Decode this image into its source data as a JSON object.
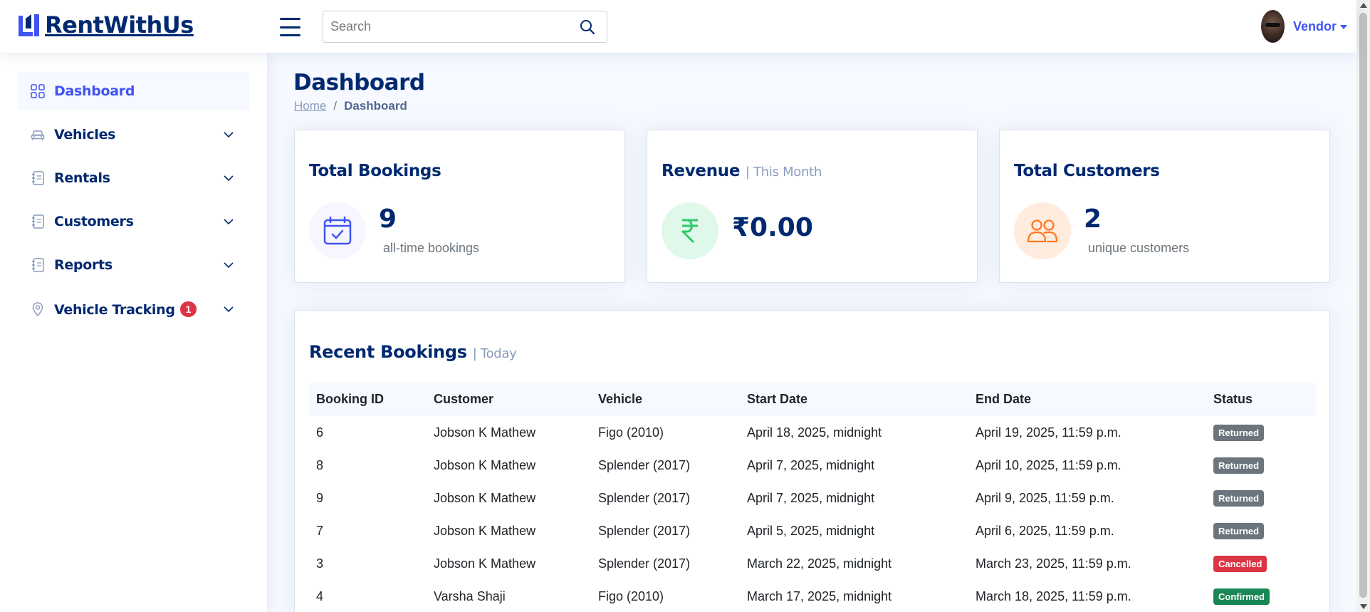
{
  "header": {
    "logo_text": "RentWithUs",
    "search_placeholder": "Search",
    "user_name": "Vendor"
  },
  "sidebar": {
    "items": [
      {
        "label": "Dashboard",
        "icon": "grid-icon",
        "active": true
      },
      {
        "label": "Vehicles",
        "icon": "car-icon"
      },
      {
        "label": "Rentals",
        "icon": "journal-icon"
      },
      {
        "label": "Customers",
        "icon": "journal-icon"
      },
      {
        "label": "Reports",
        "icon": "journal-icon"
      },
      {
        "label": "Vehicle Tracking",
        "icon": "geo-pin-icon",
        "badge": "1"
      }
    ]
  },
  "page": {
    "title": "Dashboard",
    "breadcrumb": {
      "home": "Home",
      "separator": "/",
      "current": "Dashboard"
    }
  },
  "cards": {
    "bookings": {
      "title": "Total Bookings",
      "value": "9",
      "caption": "all-time bookings",
      "icon": "calendar-check-icon"
    },
    "revenue": {
      "title": "Revenue",
      "subtitle": "| This Month",
      "value": "₹0.00",
      "icon": "rupee-icon"
    },
    "customers": {
      "title": "Total Customers",
      "value": "2",
      "caption": "unique customers",
      "icon": "people-icon"
    }
  },
  "recent_bookings": {
    "title": "Recent Bookings",
    "subtitle": "| Today",
    "columns": [
      "Booking ID",
      "Customer",
      "Vehicle",
      "Start Date",
      "End Date",
      "Status"
    ],
    "rows": [
      {
        "id": "6",
        "customer": "Jobson K Mathew",
        "vehicle": "Figo (2010)",
        "start": "April 18, 2025, midnight",
        "end": "April 19, 2025, 11:59 p.m.",
        "status": "Returned"
      },
      {
        "id": "8",
        "customer": "Jobson K Mathew",
        "vehicle": "Splender (2017)",
        "start": "April 7, 2025, midnight",
        "end": "April 10, 2025, 11:59 p.m.",
        "status": "Returned"
      },
      {
        "id": "9",
        "customer": "Jobson K Mathew",
        "vehicle": "Splender (2017)",
        "start": "April 7, 2025, midnight",
        "end": "April 9, 2025, 11:59 p.m.",
        "status": "Returned"
      },
      {
        "id": "7",
        "customer": "Jobson K Mathew",
        "vehicle": "Splender (2017)",
        "start": "April 5, 2025, midnight",
        "end": "April 6, 2025, 11:59 p.m.",
        "status": "Returned"
      },
      {
        "id": "3",
        "customer": "Jobson K Mathew",
        "vehicle": "Splender (2017)",
        "start": "March 22, 2025, midnight",
        "end": "March 23, 2025, 11:59 p.m.",
        "status": "Cancelled"
      },
      {
        "id": "4",
        "customer": "Varsha Shaji",
        "vehicle": "Figo (2010)",
        "start": "March 17, 2025, midnight",
        "end": "March 18, 2025, 11:59 p.m.",
        "status": "Confirmed"
      }
    ]
  },
  "colors": {
    "primary": "#012970",
    "accent": "#4154f1",
    "returned": "#6c757d",
    "cancelled": "#dc3545",
    "confirmed": "#198754"
  }
}
